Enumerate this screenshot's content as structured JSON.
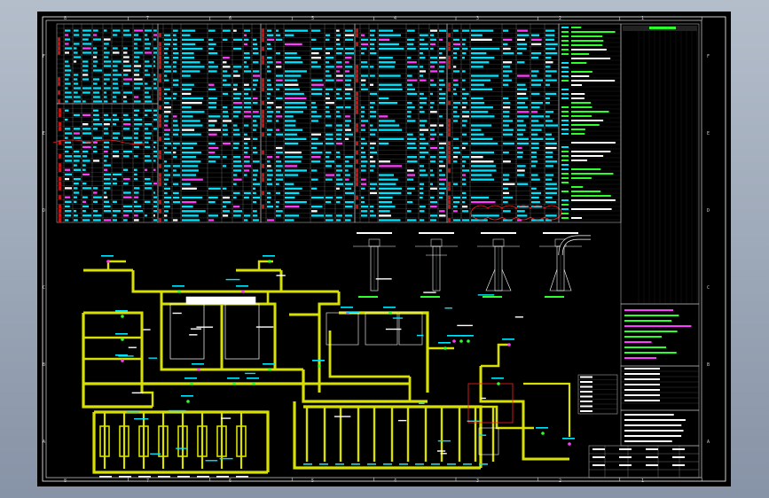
{
  "viewport": {
    "background": "#000000",
    "frame_color": "#ffffff"
  },
  "colors": {
    "pipe": "#d8e000",
    "pipe_dark": "#9aa000",
    "cyan": "#00e5ff",
    "green": "#2cff2c",
    "magenta": "#ff3cff",
    "red_cells": "#cc1111",
    "grid": "#c8c8c8",
    "revision_cloud": "#ff2020"
  },
  "border": {
    "column_numbers": [
      "8",
      "7",
      "6",
      "5",
      "4",
      "3",
      "2",
      "1"
    ],
    "row_letters": [
      "F",
      "E",
      "D",
      "C",
      "B",
      "A"
    ]
  },
  "elements": {
    "tables": [
      "pipe-schedule",
      "equipment-list",
      "legend-block",
      "notes-block",
      "revision-block",
      "title-block"
    ],
    "drawings": [
      "pipe-network",
      "vessel-details",
      "valve-manifold",
      "pump-skids"
    ],
    "icons": [
      "valve-icon",
      "pump-icon",
      "tank-icon",
      "instrument-icon",
      "flange-icon"
    ]
  }
}
